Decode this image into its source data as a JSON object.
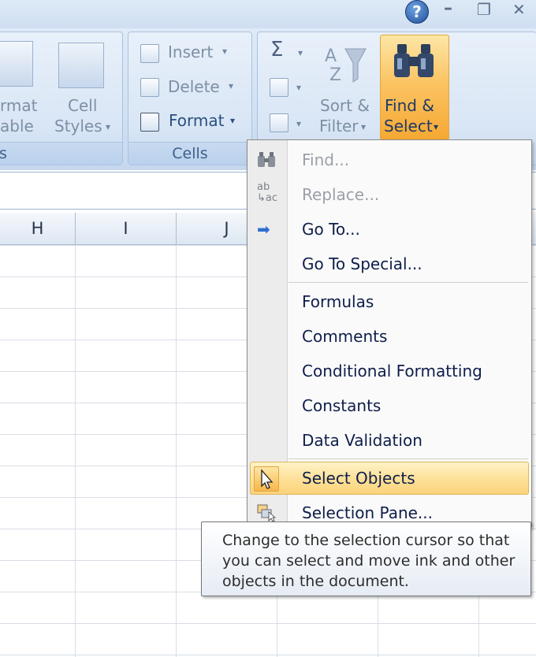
{
  "window": {
    "help_glyph": "?",
    "minimize_glyph": "–",
    "restore_glyph": "❐",
    "close_glyph": "✕"
  },
  "ribbon": {
    "styles_group": {
      "format_table_line1": "rmat",
      "format_table_line2": "able",
      "cell_styles_line1": "Cell",
      "cell_styles_line2": "Styles",
      "label": "s"
    },
    "cells_group": {
      "insert_label": "Insert",
      "delete_label": "Delete",
      "format_label": "Format",
      "label": "Cells"
    },
    "editing_group": {
      "sum_glyph": "Σ",
      "sort_filter_line1": "Sort &",
      "sort_filter_line2": "Filter",
      "find_select_line1": "Find &",
      "find_select_line2": "Select"
    },
    "dropdown_arrow": "▾"
  },
  "sheet": {
    "columns": [
      "H",
      "I",
      "J"
    ]
  },
  "menu": {
    "items": [
      {
        "label": "Find...",
        "icon": "binoculars-icon",
        "enabled": false
      },
      {
        "label": "Replace...",
        "icon": "replace-icon",
        "enabled": false
      },
      {
        "label": "Go To...",
        "icon": "arrow-right-icon",
        "enabled": true
      },
      {
        "label": "Go To Special...",
        "icon": "",
        "enabled": true
      },
      {
        "label": "Formulas",
        "icon": "",
        "enabled": true
      },
      {
        "label": "Comments",
        "icon": "",
        "enabled": true
      },
      {
        "label": "Conditional Formatting",
        "icon": "",
        "enabled": true
      },
      {
        "label": "Constants",
        "icon": "",
        "enabled": true
      },
      {
        "label": "Data Validation",
        "icon": "",
        "enabled": true
      },
      {
        "label": "Select Objects",
        "icon": "cursor-arrow-icon",
        "enabled": true,
        "highlighted": true
      },
      {
        "label": "Selection Pane...",
        "icon": "selection-pane-icon",
        "enabled": true
      }
    ],
    "icon_glyphs": {
      "binoculars": "🔍",
      "replace_top": "ab",
      "replace_bottom": "↳ac",
      "arrow_right": "➡"
    }
  },
  "tooltip": {
    "text": "Change to the selection cursor so that you can select and move ink and other objects in the document."
  },
  "colors": {
    "ribbon_bg": "#d2e1f3",
    "find_select_active": "#f6a833",
    "menu_highlight": "#fde19a",
    "grid_line": "#d9dee6"
  }
}
